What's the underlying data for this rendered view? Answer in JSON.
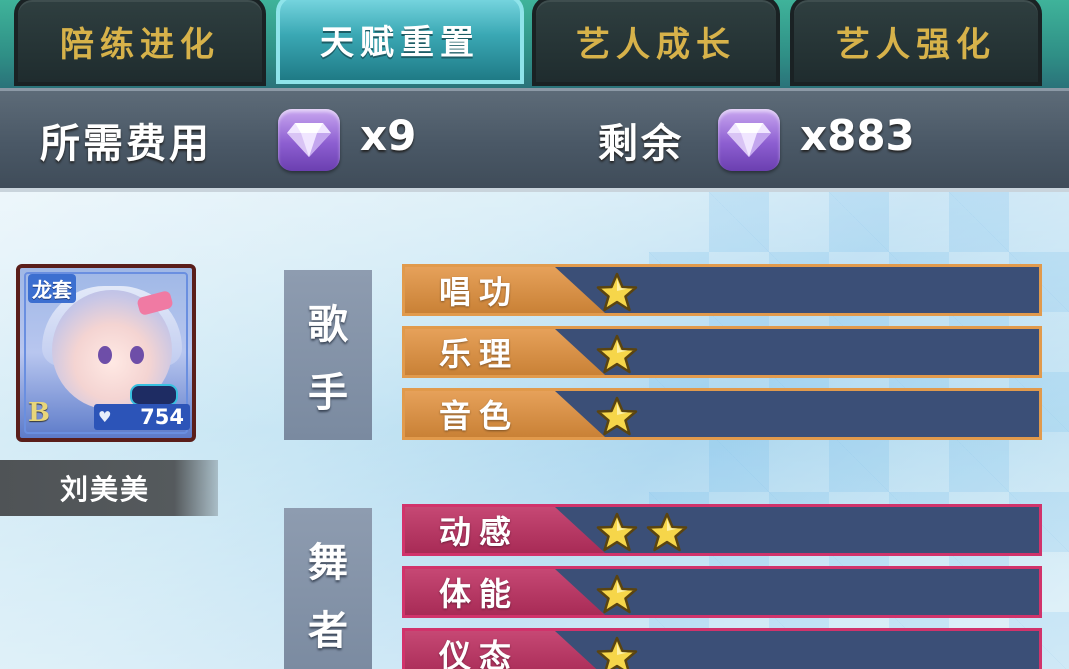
{
  "tabs": [
    {
      "label": "陪练进化",
      "active": false
    },
    {
      "label": "天赋重置",
      "active": true
    },
    {
      "label": "艺人成长",
      "active": false
    },
    {
      "label": "艺人强化",
      "active": false
    }
  ],
  "cost": {
    "required_label": "所需费用",
    "required_value": "x9",
    "remaining_label": "剩余",
    "remaining_value": "x883",
    "currency_icon": "purple-gem-icon"
  },
  "artist": {
    "name": "刘美美",
    "badge": "龙套",
    "rank": "B",
    "score": "754"
  },
  "categories": [
    {
      "id": "singer",
      "label_chars": [
        "歌",
        "手"
      ],
      "color": "#e19a4c",
      "talents": [
        {
          "label": "唱功",
          "stars": 1
        },
        {
          "label": "乐理",
          "stars": 1
        },
        {
          "label": "音色",
          "stars": 1
        }
      ]
    },
    {
      "id": "dancer",
      "label_chars": [
        "舞",
        "者"
      ],
      "color": "#d1336b",
      "talents": [
        {
          "label": "动感",
          "stars": 2
        },
        {
          "label": "体能",
          "stars": 1
        },
        {
          "label": "仪态",
          "stars": 1
        }
      ]
    }
  ]
}
